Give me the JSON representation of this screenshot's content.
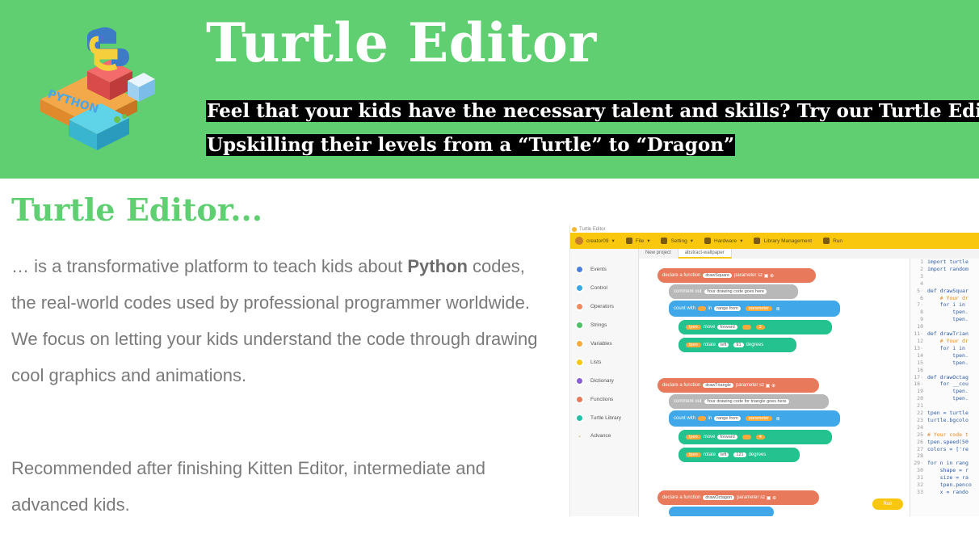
{
  "header": {
    "title": "Turtle Editor",
    "tagline_line1": "Feel that your kids have the necessary talent and skills? Try our Turtle Editor",
    "tagline_line2": "Upskilling their levels from a “Turtle” to “Dragon”",
    "logo_text": "PYTHON"
  },
  "section": {
    "title": "Turtle Editor...",
    "para1_prefix": "… is a transformative platform to teach kids about ",
    "para1_bold": "Python",
    "para1_suffix": " codes, the real-world codes used by professional programmer worldwide. We focus on letting your kids understand the code through drawing cool graphics and animations.",
    "para2": "Recommended after finishing Kitten Editor, intermediate and advanced kids."
  },
  "screenshot": {
    "window_caption": "Turtle Editor",
    "menu": {
      "user": "creator09",
      "file": "File",
      "setting": "Setting",
      "hardware": "Hardware",
      "library": "Library Management",
      "run": "Run"
    },
    "tabs": [
      "New project",
      "abstract-wallpaper"
    ],
    "categories": [
      {
        "label": "Events",
        "color": "#4a7fe0"
      },
      {
        "label": "Control",
        "color": "#3aa7e6"
      },
      {
        "label": "Operators",
        "color": "#f18a5a"
      },
      {
        "label": "Strings",
        "color": "#4cc264"
      },
      {
        "label": "Variables",
        "color": "#f7a93b"
      },
      {
        "label": "Lists",
        "color": "#f9c80e"
      },
      {
        "label": "Dictionary",
        "color": "#8a5ed6"
      },
      {
        "label": "Functions",
        "color": "#e8795a"
      },
      {
        "label": "Turtle Library",
        "color": "#23c2a8"
      },
      {
        "label": "Advance",
        "color": "#c9a24b"
      }
    ],
    "blocks": {
      "declare_square": "declare a function",
      "name_square": "drawSquare",
      "param_label": "parameter",
      "param": "sz",
      "comment_label": "comment out",
      "comment_square": "Your drawing code goes here",
      "count_with": "count with",
      "in": "in",
      "range_from": "range from",
      "parameter": "parameter",
      "move": "move",
      "forward": "forward",
      "rotate": "rotate",
      "left": "left",
      "deg_square": "91",
      "degrees": "degrees",
      "divisor_square": "2",
      "name_triangle": "drawTriangle",
      "comment_triangle": "Your drawing code for triangle goes here",
      "divisor_triangle": "4",
      "deg_triangle": "121",
      "name_octagon": "drawOctagon",
      "tpen": "tpen",
      "run_button": "Run"
    },
    "code_lines": [
      [
        "1",
        "import turtle"
      ],
      [
        "2",
        "import random"
      ],
      [
        "3",
        ""
      ],
      [
        "4",
        ""
      ],
      [
        "5·",
        "def drawSquar"
      ],
      [
        "6",
        "    # Your dr"
      ],
      [
        "7·",
        "    for i in"
      ],
      [
        "8",
        "        tpen."
      ],
      [
        "9",
        "        tpen."
      ],
      [
        "10",
        ""
      ],
      [
        "11·",
        "def drawTrian"
      ],
      [
        "12",
        "    # Your dr"
      ],
      [
        "13·",
        "    for i in"
      ],
      [
        "14",
        "        tpen."
      ],
      [
        "15",
        "        tpen."
      ],
      [
        "16",
        ""
      ],
      [
        "17·",
        "def drawOctag"
      ],
      [
        "18·",
        "    for __cou"
      ],
      [
        "19",
        "        tpen."
      ],
      [
        "20",
        "        tpen."
      ],
      [
        "21",
        ""
      ],
      [
        "22",
        "tpen = turtle"
      ],
      [
        "23",
        "turtle.bgcolo"
      ],
      [
        "24",
        ""
      ],
      [
        "25",
        "# Your code t"
      ],
      [
        "26",
        "tpen.speed(50"
      ],
      [
        "27",
        "colors = ['re"
      ],
      [
        "28",
        ""
      ],
      [
        "29·",
        "for n in rang"
      ],
      [
        "30",
        "    shape = r"
      ],
      [
        "31",
        "    size = ra"
      ],
      [
        "32",
        "    tpen.penco"
      ],
      [
        "33",
        "    x = rando"
      ]
    ]
  },
  "colors": {
    "brand_green": "#5fcf71",
    "editor_yellow": "#f9c80e",
    "text_gray": "#7a7a7a"
  }
}
